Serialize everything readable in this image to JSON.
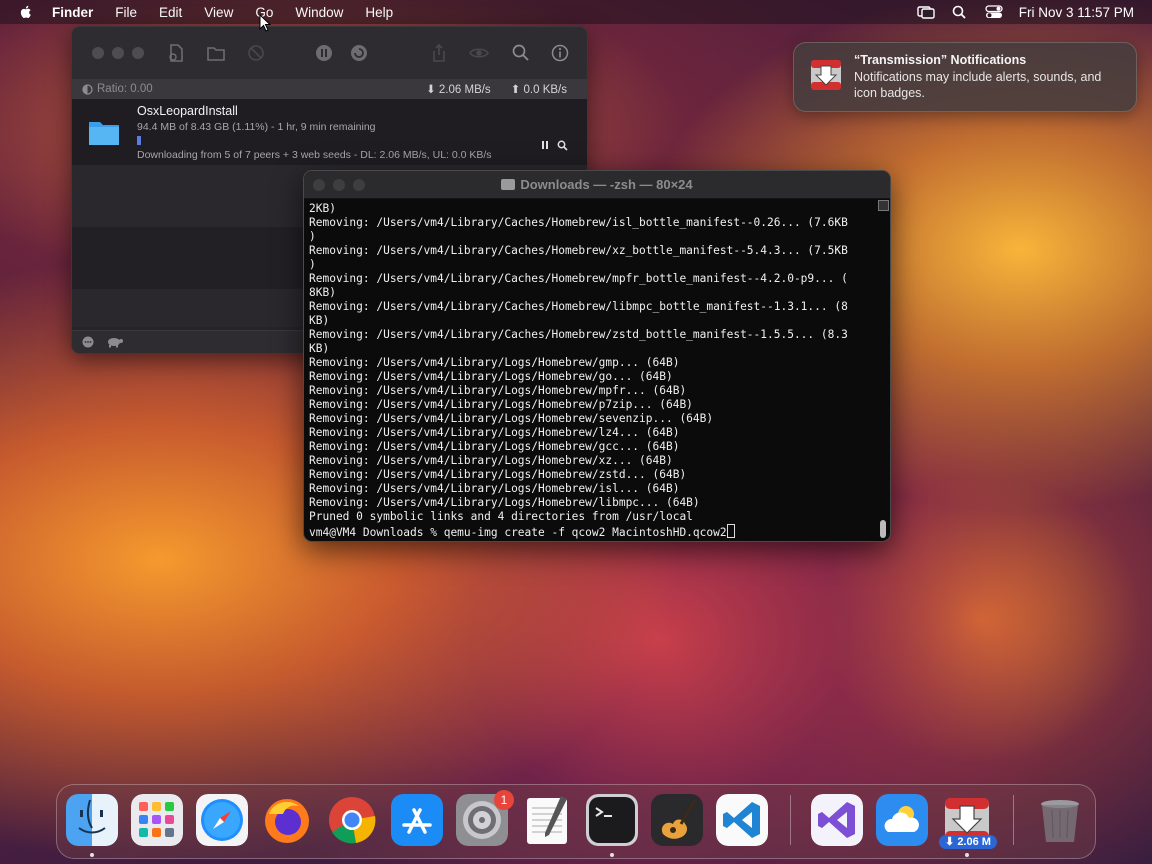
{
  "menubar": {
    "app_name": "Finder",
    "items": [
      "File",
      "Edit",
      "View",
      "Go",
      "Window",
      "Help"
    ],
    "clock": "Fri Nov 3  11:57 PM"
  },
  "transmission": {
    "ratio": "Ratio: 0.00",
    "download_rate": "2.06 MB/s",
    "upload_rate": "0.0 KB/s",
    "torrent": {
      "name": "OsxLeopardInstall",
      "progress_info": "94.4 MB of 8.43 GB (1.11%) - 1 hr, 9 min remaining",
      "progress_fraction": 0.0111,
      "status": "Downloading from 5 of 7 peers + 3 web seeds - DL: 2.06 MB/s, UL: 0.0 KB/s"
    }
  },
  "terminal": {
    "title": "Downloads — -zsh — 80×24",
    "lines": [
      "2KB)",
      "Removing: /Users/vm4/Library/Caches/Homebrew/isl_bottle_manifest--0.26... (7.6KB",
      ")",
      "Removing: /Users/vm4/Library/Caches/Homebrew/xz_bottle_manifest--5.4.3... (7.5KB",
      ")",
      "Removing: /Users/vm4/Library/Caches/Homebrew/mpfr_bottle_manifest--4.2.0-p9... (",
      "8KB)",
      "Removing: /Users/vm4/Library/Caches/Homebrew/libmpc_bottle_manifest--1.3.1... (8",
      "KB)",
      "Removing: /Users/vm4/Library/Caches/Homebrew/zstd_bottle_manifest--1.5.5... (8.3",
      "KB)",
      "Removing: /Users/vm4/Library/Logs/Homebrew/gmp... (64B)",
      "Removing: /Users/vm4/Library/Logs/Homebrew/go... (64B)",
      "Removing: /Users/vm4/Library/Logs/Homebrew/mpfr... (64B)",
      "Removing: /Users/vm4/Library/Logs/Homebrew/p7zip... (64B)",
      "Removing: /Users/vm4/Library/Logs/Homebrew/sevenzip... (64B)",
      "Removing: /Users/vm4/Library/Logs/Homebrew/lz4... (64B)",
      "Removing: /Users/vm4/Library/Logs/Homebrew/gcc... (64B)",
      "Removing: /Users/vm4/Library/Logs/Homebrew/xz... (64B)",
      "Removing: /Users/vm4/Library/Logs/Homebrew/zstd... (64B)",
      "Removing: /Users/vm4/Library/Logs/Homebrew/isl... (64B)",
      "Removing: /Users/vm4/Library/Logs/Homebrew/libmpc... (64B)",
      "Pruned 0 symbolic links and 4 directories from /usr/local"
    ],
    "prompt": "vm4@VM4 Downloads % qemu-img create -f qcow2 MacintoshHD.qcow2"
  },
  "notification": {
    "title": "“Transmission” Notifications",
    "body": "Notifications may include alerts, sounds, and icon badges."
  },
  "dock": {
    "apps": [
      "finder-icon",
      "launchpad-icon",
      "safari-icon",
      "firefox-icon",
      "chrome-icon",
      "app-store-icon",
      "system-settings-icon",
      "textedit-icon",
      "terminal-icon",
      "garageband-icon",
      "vscode-icon",
      "visual-studio-icon",
      "weather-icon",
      "transmission-icon",
      "trash-icon"
    ],
    "settings_badge": "1",
    "transmission_badge": "2.06 M"
  }
}
